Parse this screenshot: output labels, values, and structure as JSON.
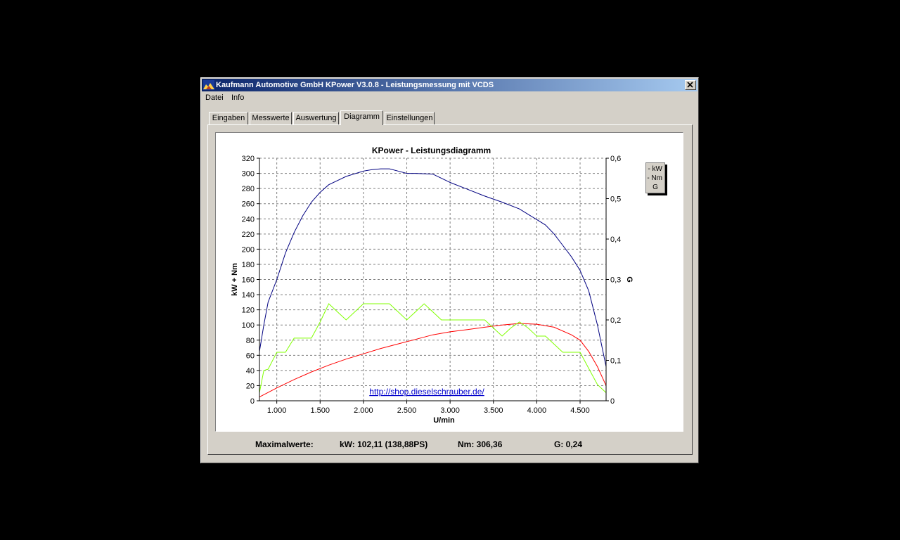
{
  "window": {
    "title": "Kaufmann Automotive GmbH  KPower V3.0.8 - Leistungsmessung mit VCDS",
    "close_label": "×"
  },
  "menu": [
    "Datei",
    "Info"
  ],
  "tabs": [
    {
      "label": "Eingaben",
      "active": false
    },
    {
      "label": "Messwerte",
      "active": false
    },
    {
      "label": "Auswertung",
      "active": false
    },
    {
      "label": "Diagramm",
      "active": true
    },
    {
      "label": "Einstellungen",
      "active": false
    }
  ],
  "legend": {
    "items": [
      "- kW",
      "- Nm",
      "G"
    ]
  },
  "link": {
    "text": "http://shop.dieselschrauber.de/"
  },
  "status": {
    "label": "Maximalwerte:",
    "kw": "kW: 102,11 (138,88PS)",
    "nm": "Nm: 306,36",
    "g": "G: 0,24"
  },
  "colors": {
    "kw": "#ff0000",
    "nm": "#000080",
    "g": "#80ff00",
    "titlebar_start": "#0a246a",
    "titlebar_end": "#a6caf0",
    "link": "#0000cc"
  },
  "chart_data": {
    "type": "line",
    "title": "KPower - Leistungsdiagramm",
    "xlabel": "U/min",
    "ylabel": "kW + Nm",
    "y2label": "G",
    "xlim": [
      800,
      4800
    ],
    "ylim": [
      0,
      320
    ],
    "y2lim": [
      0,
      0.6
    ],
    "xticks": [
      1000,
      1500,
      2000,
      2500,
      3000,
      3500,
      4000,
      4500
    ],
    "xtick_labels": [
      "1.000",
      "1.500",
      "2.000",
      "2.500",
      "3.000",
      "3.500",
      "4.000",
      "4.500"
    ],
    "yticks": [
      0,
      20,
      40,
      60,
      80,
      100,
      120,
      140,
      160,
      180,
      200,
      220,
      240,
      260,
      280,
      300,
      320
    ],
    "y2ticks": [
      0,
      0.1,
      0.2,
      0.3,
      0.4,
      0.5,
      0.6
    ],
    "y2tick_labels": [
      "0",
      "0,1",
      "0,2",
      "0,3",
      "0,4",
      "0,5",
      "0,6"
    ],
    "grid": true,
    "legend_position": "right",
    "series": [
      {
        "name": "kW",
        "axis": "y",
        "color": "#ff0000",
        "x": [
          800,
          1000,
          1200,
          1400,
          1600,
          1800,
          2000,
          2200,
          2400,
          2600,
          2800,
          3000,
          3200,
          3400,
          3600,
          3800,
          4000,
          4200,
          4400,
          4500,
          4600,
          4700,
          4800
        ],
        "y": [
          5,
          17,
          28,
          38,
          47,
          55,
          62,
          69,
          75,
          81,
          87,
          91,
          94,
          97,
          100,
          102,
          101,
          97,
          87,
          80,
          65,
          45,
          20
        ]
      },
      {
        "name": "Nm",
        "axis": "y",
        "color": "#000080",
        "x": [
          800,
          850,
          900,
          1000,
          1100,
          1200,
          1300,
          1400,
          1500,
          1600,
          1800,
          2000,
          2100,
          2200,
          2300,
          2400,
          2500,
          2600,
          2800,
          3000,
          3200,
          3400,
          3600,
          3800,
          3900,
          4000,
          4100,
          4200,
          4300,
          4400,
          4500,
          4600,
          4700,
          4800
        ],
        "y": [
          65,
          100,
          130,
          160,
          195,
          222,
          244,
          262,
          275,
          285,
          296,
          303,
          305,
          306,
          306,
          303,
          300,
          300,
          299,
          288,
          279,
          270,
          262,
          253,
          246,
          239,
          232,
          220,
          205,
          190,
          172,
          145,
          100,
          45
        ]
      },
      {
        "name": "G",
        "axis": "y2",
        "color": "#80ff00",
        "x": [
          800,
          850,
          900,
          1000,
          1100,
          1200,
          1300,
          1400,
          1500,
          1600,
          1700,
          1800,
          1900,
          2000,
          2100,
          2200,
          2300,
          2400,
          2500,
          2600,
          2700,
          2800,
          2900,
          3000,
          3100,
          3200,
          3300,
          3400,
          3500,
          3600,
          3700,
          3800,
          3900,
          4000,
          4100,
          4200,
          4300,
          4400,
          4500,
          4600,
          4700,
          4800
        ],
        "y": [
          0.02,
          0.075,
          0.078,
          0.12,
          0.12,
          0.155,
          0.155,
          0.155,
          0.195,
          0.24,
          0.22,
          0.2,
          0.22,
          0.24,
          0.24,
          0.24,
          0.24,
          0.22,
          0.2,
          0.22,
          0.24,
          0.22,
          0.2,
          0.2,
          0.2,
          0.2,
          0.2,
          0.2,
          0.18,
          0.16,
          0.18,
          0.195,
          0.18,
          0.16,
          0.16,
          0.14,
          0.12,
          0.12,
          0.12,
          0.08,
          0.04,
          0.02
        ]
      }
    ]
  }
}
